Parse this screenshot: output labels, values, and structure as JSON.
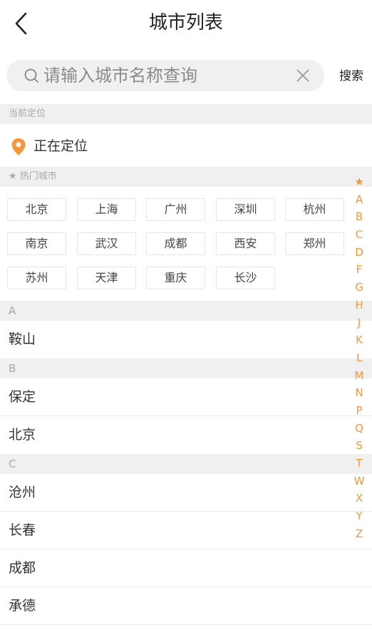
{
  "header": {
    "title": "城市列表"
  },
  "search": {
    "placeholder": "请输入城市名称查询",
    "button_label": "搜索"
  },
  "location": {
    "section_title": "当前定位",
    "status_text": "正在定位"
  },
  "hot": {
    "section_title": "★ 热门城市",
    "cities": [
      "北京",
      "上海",
      "广州",
      "深圳",
      "杭州",
      "南京",
      "武汉",
      "成都",
      "西安",
      "郑州",
      "苏州",
      "天津",
      "重庆",
      "长沙"
    ]
  },
  "groups": [
    {
      "letter": "A",
      "cities": [
        "鞍山"
      ]
    },
    {
      "letter": "B",
      "cities": [
        "保定",
        "北京"
      ]
    },
    {
      "letter": "C",
      "cities": [
        "沧州",
        "长春",
        "成都",
        "承德"
      ]
    }
  ],
  "index": [
    "★",
    "A",
    "B",
    "C",
    "D",
    "F",
    "G",
    "H",
    "J",
    "K",
    "L",
    "M",
    "N",
    "P",
    "Q",
    "S",
    "T",
    "W",
    "X",
    "Y",
    "Z"
  ],
  "colors": {
    "accent": "#f5973a",
    "section_bg": "#f0f0f0",
    "search_bg": "#f0f0f0"
  },
  "icons": {
    "back": "chevron-left-icon",
    "search": "search-icon",
    "clear": "close-icon",
    "location": "map-pin-icon"
  }
}
